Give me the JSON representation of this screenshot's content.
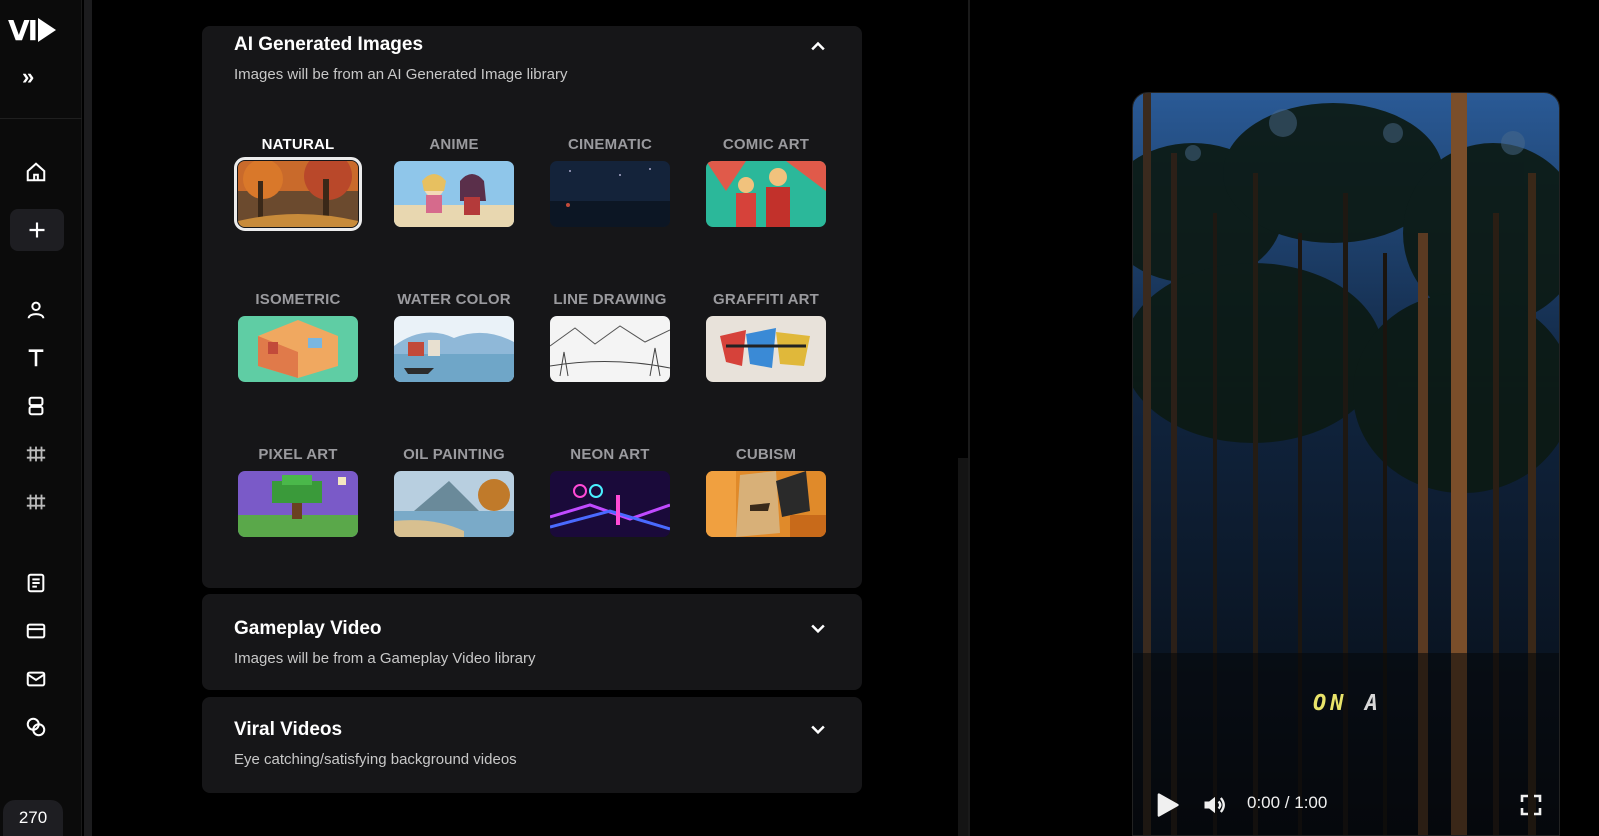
{
  "app": {
    "logo": "VI",
    "credits": "270"
  },
  "sidebar": {
    "icons": [
      "expand-icon",
      "home-icon",
      "plus-icon",
      "user-icon",
      "text-icon",
      "layers-icon",
      "film-icon",
      "film-icon",
      "book-icon",
      "card-icon",
      "mail-icon",
      "coins-icon"
    ]
  },
  "ai_images": {
    "title": "AI Generated Images",
    "subtitle": "Images will be from an AI Generated Image library",
    "expanded": true,
    "selected": "NATURAL",
    "styles": [
      {
        "label": "NATURAL"
      },
      {
        "label": "ANIME"
      },
      {
        "label": "CINEMATIC"
      },
      {
        "label": "COMIC ART"
      },
      {
        "label": "ISOMETRIC"
      },
      {
        "label": "WATER COLOR"
      },
      {
        "label": "LINE DRAWING"
      },
      {
        "label": "GRAFFITI ART"
      },
      {
        "label": "PIXEL ART"
      },
      {
        "label": "OIL PAINTING"
      },
      {
        "label": "NEON ART"
      },
      {
        "label": "CUBISM"
      }
    ]
  },
  "gameplay": {
    "title": "Gameplay Video",
    "subtitle": "Images will be from a Gameplay Video library"
  },
  "viral": {
    "title": "Viral Videos",
    "subtitle": "Eye catching/satisfying background videos"
  },
  "preview": {
    "caption_highlight": "ON",
    "caption_rest": "A",
    "time": "0:00 / 1:00",
    "accent": "#e9e46a"
  }
}
